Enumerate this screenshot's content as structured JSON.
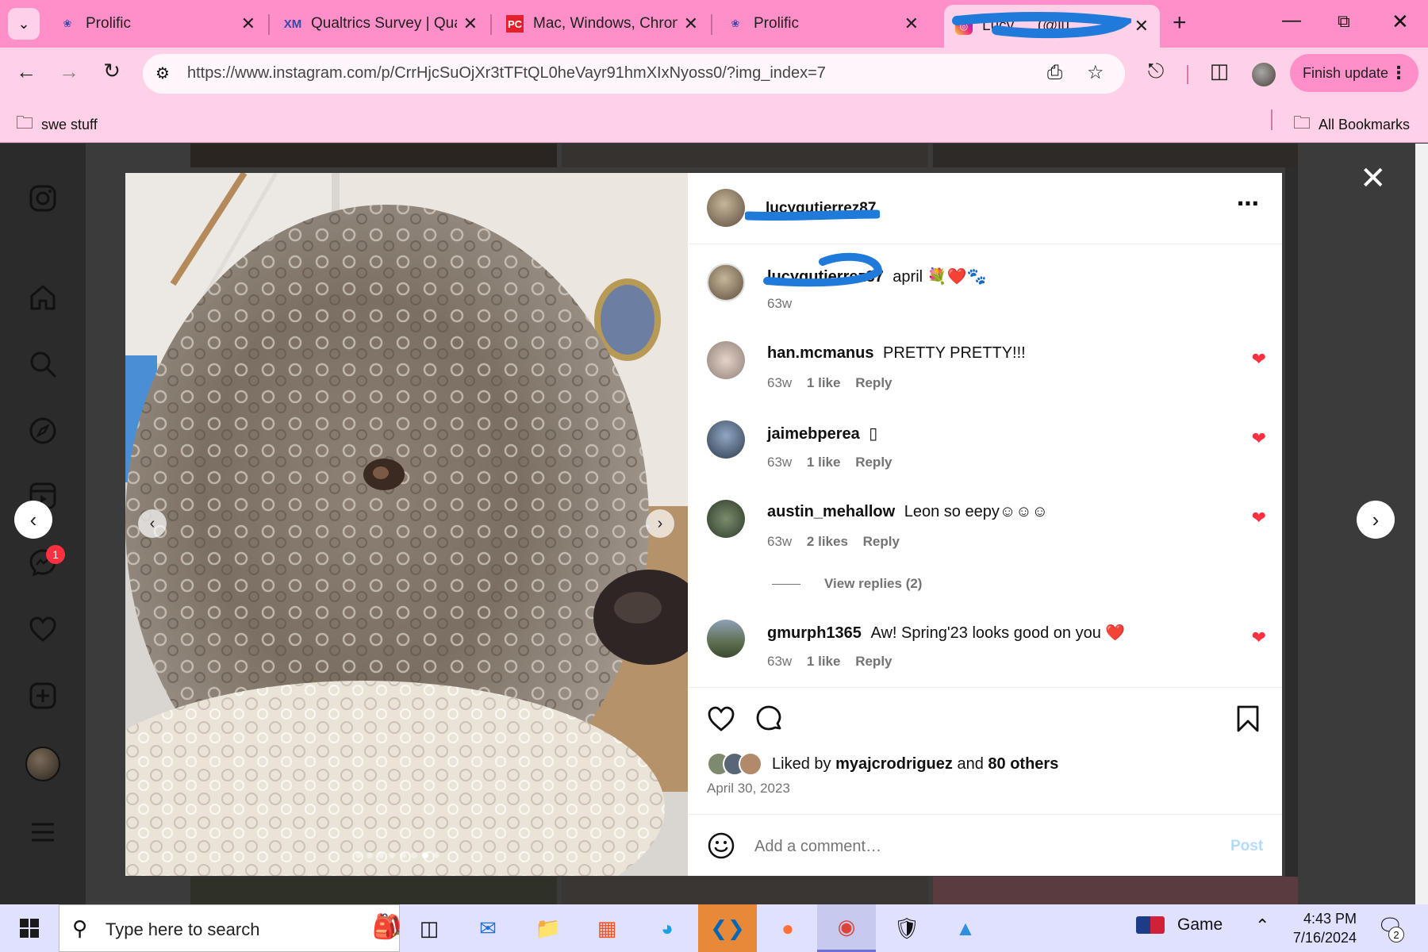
{
  "browser": {
    "tabs": [
      {
        "title": "Prolific",
        "favicon": "prolific-icon"
      },
      {
        "title": "Qualtrics Survey | Qua",
        "favicon": "qualtrics-icon"
      },
      {
        "title": "Mac, Windows, Chron",
        "favicon": "pcmag-icon"
      },
      {
        "title": "Prolific",
        "favicon": "prolific-icon"
      },
      {
        "title": "Lucy … (@lu…",
        "favicon": "instagram-icon",
        "active": true
      }
    ],
    "url": "https://www.instagram.com/p/CrrHjcSuOjXr3tTFtQL0heVayr91hmXIxNyoss0/?img_index=7",
    "finish_update": "Finish update",
    "bookmarks": [
      {
        "label": "swe stuff"
      }
    ],
    "all_bookmarks": "All Bookmarks"
  },
  "post": {
    "username": "lucygutierrez87",
    "caption_user": "lucygutierrez87",
    "caption_text": "april 💐❤️🐾",
    "caption_time": "63w",
    "comments": [
      {
        "user": "han.mcmanus",
        "text": "PRETTY PRETTY!!!",
        "time": "63w",
        "likes": "1 like",
        "reply": "Reply"
      },
      {
        "user": "jaimebperea",
        "text": "▯",
        "time": "63w",
        "likes": "1 like",
        "reply": "Reply"
      },
      {
        "user": "austin_mehallow",
        "text": "Leon so eepy☺☺☺",
        "time": "63w",
        "likes": "2 likes",
        "reply": "Reply",
        "view_replies": "View replies (2)"
      },
      {
        "user": "gmurph1365",
        "text": "Aw! Spring'23 looks good on you ❤️",
        "time": "63w",
        "likes": "1 like",
        "reply": "Reply"
      }
    ],
    "liked_by_prefix": "Liked by",
    "liked_by_user": "myajcrodriguez",
    "liked_by_and": "and",
    "liked_by_others": "80 others",
    "date": "April 30, 2023",
    "comment_placeholder": "Add a comment…",
    "post_button": "Post",
    "carousel": {
      "count": 8,
      "active_index": 6
    }
  },
  "sidenav": {
    "notifications_badge": "1"
  },
  "taskbar": {
    "search_placeholder": "Type here to search",
    "weather_label": "Game",
    "time": "4:43 PM",
    "date": "7/16/2024",
    "notification_count": "2"
  },
  "colors": {
    "tabstrip": "#ff8fc8",
    "toolbar": "#ffd1e8",
    "heart": "#ff3040",
    "link_blue": "#0095f6"
  }
}
